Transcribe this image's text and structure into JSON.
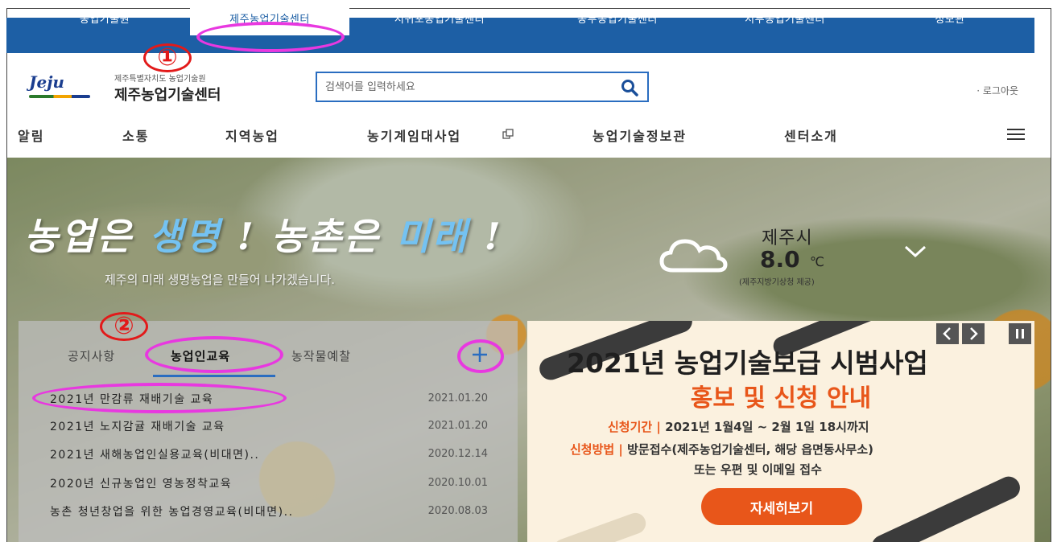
{
  "top_sites": [
    {
      "label": "농업기술원"
    },
    {
      "label": "제주농업기술센터"
    },
    {
      "label": "서귀포농업기술센터"
    },
    {
      "label": "동부농업기술센터"
    },
    {
      "label": "서부농업기술센터"
    },
    {
      "label": "정보관"
    }
  ],
  "header": {
    "logo_text": "Jeju",
    "org_small": "제주특별자치도 농업기술원",
    "org_name": "제주농업기술센터",
    "search_placeholder": "검색어를 입력하세요",
    "logout": "· 로그아웃"
  },
  "nav": {
    "items": [
      "알림",
      "소통",
      "지역농업",
      "농기계임대사업",
      "농업기술정보관",
      "센터소개"
    ]
  },
  "hero": {
    "slogan_a": "농업은 ",
    "slogan_b": "생명",
    "slogan_c": " ! 농촌은 ",
    "slogan_d": "미래",
    "slogan_e": " !",
    "subtitle": "제주의 미래 생명농업을 만들어 나가겠습니다."
  },
  "weather": {
    "city": "제주시",
    "temp": "8.0",
    "unit": "℃",
    "source": "(제주지방기상청 제공)",
    "icon": "cloud-icon"
  },
  "board": {
    "tabs": [
      "공지사항",
      "농업인교육",
      "농작물예찰"
    ],
    "active_tab": "농업인교육",
    "more": "+",
    "rows": [
      {
        "title": "2021년 만감류 재배기술 교육",
        "date": "2021.01.20"
      },
      {
        "title": "2021년 노지감귤 재배기술 교육",
        "date": "2021.01.20"
      },
      {
        "title": "2021년 새해농업인실용교육(비대면)..",
        "date": "2020.12.14"
      },
      {
        "title": "2020년 신규농업인 영농정착교육",
        "date": "2020.10.01"
      },
      {
        "title": "농촌 청년창업을 위한 농업경영교육(비대면)..",
        "date": "2020.08.03"
      }
    ]
  },
  "banner": {
    "title": "2021년 농업기술보급 시범사업",
    "subtitle": "홍보 및 신청 안내",
    "period_label": "신청기간 |",
    "period_value": " 2021년 1월4일 ~ 2월 1일 18시까지",
    "method_label": "신청방법 |",
    "method_value": " 방문접수(제주농업기술센터, 해당 읍면동사무소)",
    "method_value2": "또는 우편 및 이메일 접수",
    "button": "자세히보기"
  },
  "annotations": {
    "marker_1": "①",
    "marker_2": "②"
  },
  "colors": {
    "top_bar": "#1d5fa5",
    "accent_orange": "#e8561a",
    "annotation_ring": "#e838e0",
    "annotation_number": "#e21a1a"
  }
}
